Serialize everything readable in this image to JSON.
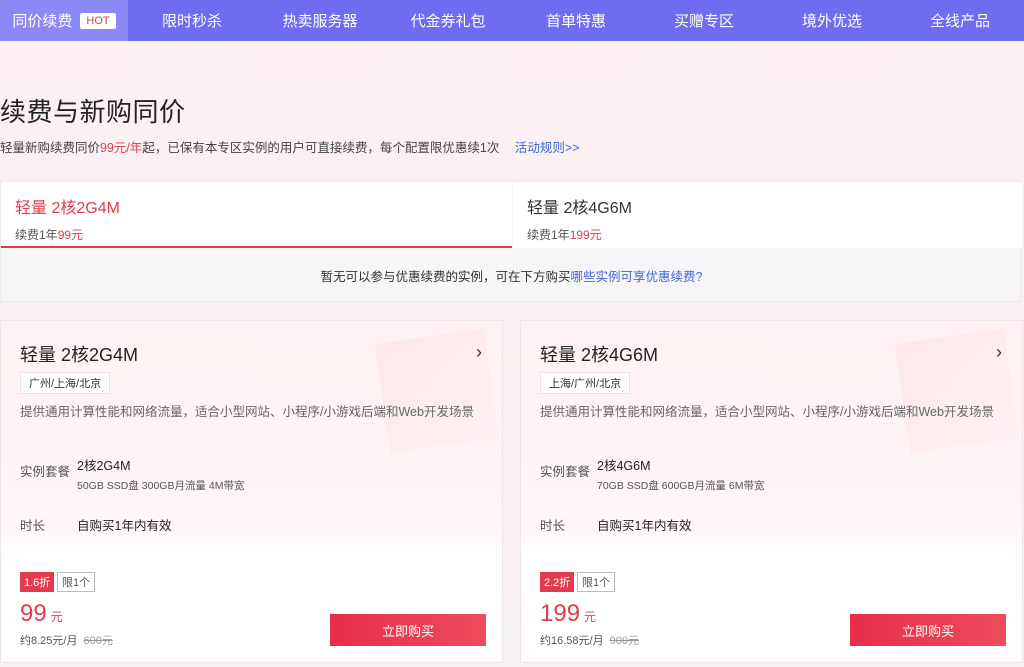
{
  "nav": {
    "items": [
      {
        "label": "同价续费",
        "badge": "HOT"
      },
      {
        "label": "限时秒杀"
      },
      {
        "label": "热卖服务器"
      },
      {
        "label": "代金券礼包"
      },
      {
        "label": "首单特惠"
      },
      {
        "label": "买赠专区"
      },
      {
        "label": "境外优选"
      },
      {
        "label": "全线产品"
      }
    ]
  },
  "hero": {
    "title": "续费与新购同价",
    "sub_pre": "轻量新购续费同价",
    "sub_price": "99元/年",
    "sub_post": "起，已保有本专区实例的用户可直接续费，每个配置限优惠续1次",
    "rules_link": "活动规则>>"
  },
  "tabs": [
    {
      "name": "轻量 2核2G4M",
      "price_pre": "续费1年",
      "price": "99元"
    },
    {
      "name": "轻量 2核4G6M",
      "price_pre": "续费1年",
      "price": "199元"
    }
  ],
  "empty_note": {
    "text": "暂无可以参与优惠续费的实例，可在下方购买",
    "link": "哪些实例可享优惠续费?"
  },
  "cards": [
    {
      "title": "轻量 2核2G4M",
      "arrow": "›",
      "regions": "广州/上海/北京",
      "desc": "提供通用计算性能和网络流量，适合小型网站、小程序/小游戏后端和Web开发场景",
      "spec_label": "实例套餐",
      "spec_value": "2核2G4M",
      "spec_detail": "50GB SSD盘 300GB月流量 4M带宽",
      "duration_label": "时长",
      "duration_value": "自购买1年内有效",
      "discount": "1.6折",
      "limit": "限1个",
      "price": "99",
      "price_unit": "元",
      "per_month": "约8.25元/月",
      "original": "600元",
      "buy": "立即购买"
    },
    {
      "title": "轻量 2核4G6M",
      "arrow": "›",
      "regions": "上海/广州/北京",
      "desc": "提供通用计算性能和网络流量，适合小型网站、小程序/小游戏后端和Web开发场景",
      "spec_label": "实例套餐",
      "spec_value": "2核4G6M",
      "spec_detail": "70GB SSD盘 600GB月流量 6M带宽",
      "duration_label": "时长",
      "duration_value": "自购买1年内有效",
      "discount": "2.2折",
      "limit": "限1个",
      "price": "199",
      "price_unit": "元",
      "per_month": "约16.58元/月",
      "original": "900元",
      "buy": "立即购买"
    }
  ]
}
